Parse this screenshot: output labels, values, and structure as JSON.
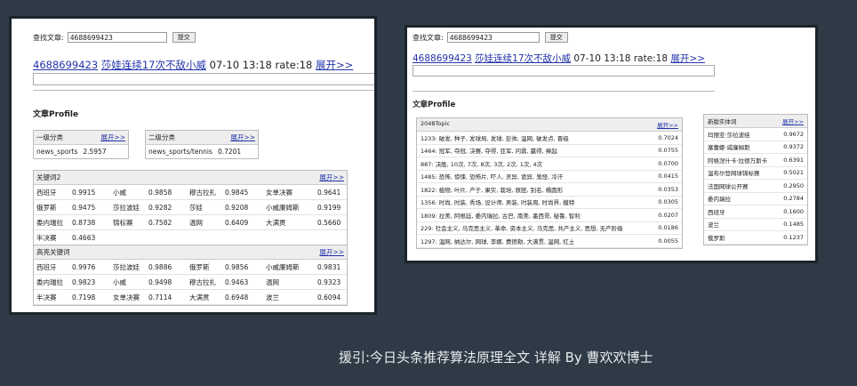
{
  "colors": {
    "page_bg": "#2e3a45",
    "link": "#2233aa",
    "header_bg": "#eeeeee"
  },
  "search": {
    "label": "查找文章:",
    "value": "4688699423",
    "button": "提交"
  },
  "result": {
    "id": "4688699423",
    "title": "莎娃连续17次不敌小威",
    "meta": "07-10 13:18 rate:18",
    "expand": "展开>>"
  },
  "profile": {
    "title": "文章Profile",
    "expand": "展开>>",
    "level1": {
      "label": "一级分类",
      "name": "news_sports",
      "score": "2.5957"
    },
    "level2": {
      "label": "二级分类",
      "name": "news_sports/tennis",
      "score": "0.7201"
    },
    "kw2": {
      "title": "关键词2",
      "rows": [
        [
          "西班牙",
          "0.9915",
          "小威",
          "0.9858",
          "穆古拉扎",
          "0.9845",
          "女单决赛",
          "0.9641"
        ],
        [
          "俄罗斯",
          "0.9475",
          "莎拉波娃",
          "0.9282",
          "莎娃",
          "0.9208",
          "小威廉姆斯",
          "0.9199"
        ],
        [
          "委内瑞拉",
          "0.8738",
          "锦标赛",
          "0.7582",
          "温网",
          "0.6409",
          "大满贯",
          "0.5660"
        ],
        [
          "半决赛",
          "0.4663",
          "",
          "",
          "",
          "",
          "",
          ""
        ]
      ]
    },
    "kw_high": {
      "title": "高亮关键词",
      "rows": [
        [
          "西班牙",
          "0.9976",
          "莎拉波娃",
          "0.9886",
          "俄罗斯",
          "0.9856",
          "小威廉姆斯",
          "0.9831"
        ],
        [
          "委内瑞拉",
          "0.9823",
          "小威",
          "0.9498",
          "穆古拉扎",
          "0.9463",
          "温网",
          "0.9323"
        ],
        [
          "半决赛",
          "0.7198",
          "女单决赛",
          "0.7114",
          "大满贯",
          "0.6948",
          "波兰",
          "0.6094"
        ]
      ]
    },
    "topic": {
      "title": "2048Topic",
      "rows": [
        [
          "1233: 破发, 种子, 发球局, 发球, 彭帅, 温网, 破发点, 晋级",
          "0.7024"
        ],
        [
          "1464: 冠军, 夺冠, 决赛, 夺得, 亚军, 问鼎, 赢得, 捧起",
          "0.0755"
        ],
        [
          "887: 决胜, 10次, 7次, 8次, 3次, 2次, 1次, 4次",
          "0.0700"
        ],
        [
          "1485: 恐怖, 惊悚, 恐怖片, 吓人, 灵异, 诡异, 鬼怪, 冷汗",
          "0.0415"
        ],
        [
          "1822: 植物, 叶片, 产于, 果实, 栽培, 原胚, 别名, 椭圆形",
          "0.0353"
        ],
        [
          "1356: 时尚, 时装, 秀场, 设计师, 男装, 时装周, 时尚界, 模特",
          "0.0305"
        ],
        [
          "1809: 拉美, 阿根廷, 委内瑞拉, 古巴, 南美, 墨西哥, 秘鲁, 智利",
          "0.0207"
        ],
        [
          "229: 社会主义, 马克思主义, 革命, 资本主义, 马克思, 共产主义, 思想, 无产阶级",
          "0.0186"
        ],
        [
          "1297: 温网, 纳达尔, 网球, 李娜, 费德勒, 大满贯, 温网, 红土",
          "0.0055"
        ]
      ]
    },
    "entity": {
      "title": "新版实体词",
      "rows": [
        [
          "玛丽亚·莎拉波娃",
          "0.9672"
        ],
        [
          "塞蕾娜·威廉姆斯",
          "0.9372"
        ],
        [
          "阿格涅什卡·拉德万斯卡",
          "0.6391"
        ],
        [
          "温布尔登网球锦标赛",
          "0.5021"
        ],
        [
          "法国网球公开赛",
          "0.2950"
        ],
        [
          "委内瑞拉",
          "0.2784"
        ],
        [
          "西班牙",
          "0.1600"
        ],
        [
          "波兰",
          "0.1485"
        ],
        [
          "俄罗斯",
          "0.1237"
        ]
      ]
    }
  },
  "caption": "援引:今日头条推荐算法原理全文 详解  By 曹欢欢博士"
}
